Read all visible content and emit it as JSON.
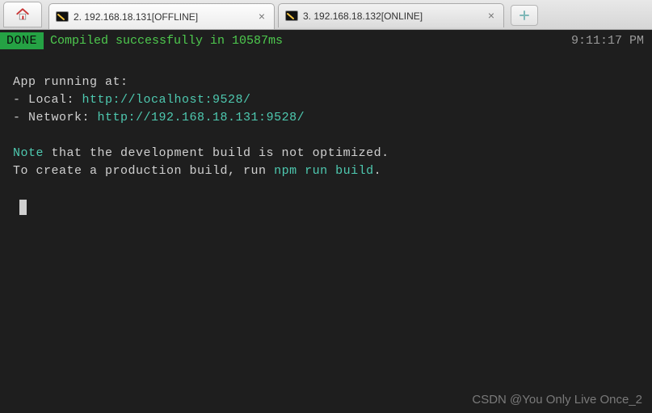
{
  "tabbar": {
    "tabs": [
      {
        "label": "2. 192.168.18.131[OFFLINE]"
      },
      {
        "label": "3. 192.168.18.132[ONLINE]"
      }
    ],
    "newtab": "+"
  },
  "status": {
    "done": "DONE",
    "compiled": "Compiled successfully in 10587ms",
    "clock": "9:11:17 PM"
  },
  "lines": {
    "intro": "App running at:",
    "local_label": "- Local:   ",
    "local_url": "http://localhost:9528/",
    "net_label": "- Network: ",
    "net_url": "http://192.168.18.131:9528/",
    "note_word": "Note",
    "note_rest": " that the development build is not optimized.",
    "build_pre": "To create a production build, run ",
    "build_cmd": "npm run build",
    "build_post": "."
  },
  "watermark": "CSDN @You Only Live Once_2"
}
